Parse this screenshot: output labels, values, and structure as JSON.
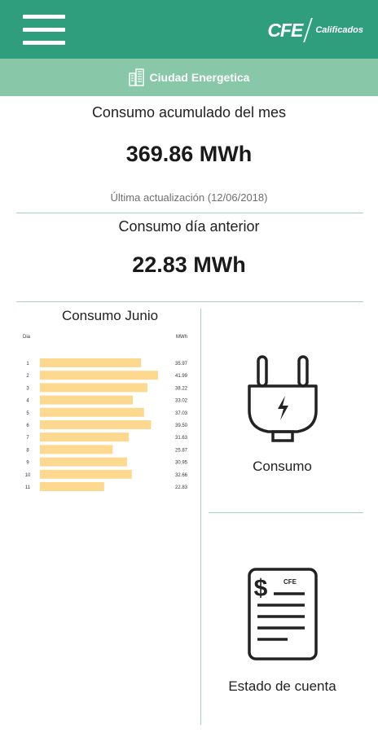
{
  "header": {
    "brand_logo": "CFE",
    "brand_sub": "Calificados",
    "subtitle": "Ciudad Energetica"
  },
  "monthly": {
    "title": "Consumo acumulado del mes",
    "value": "369.86 MWh",
    "updated": "Última actualización (12/06/2018)"
  },
  "previous_day": {
    "title": "Consumo día anterior",
    "value": "22.83 MWh"
  },
  "chart_data": {
    "type": "bar",
    "orientation": "horizontal",
    "title": "Consumo Junio",
    "col_left": "Dia",
    "col_right": "MWh",
    "categories": [
      "1",
      "2",
      "3",
      "4",
      "5",
      "6",
      "7",
      "8",
      "9",
      "10",
      "11"
    ],
    "values": [
      35.97,
      41.99,
      38.22,
      33.02,
      37.03,
      39.5,
      31.63,
      25.87,
      30.95,
      32.66,
      22.83
    ],
    "labels": [
      "35.97",
      "41.99",
      "38.22",
      "33.02",
      "37.03",
      "39.50",
      "31.63",
      "25.87",
      "30.95",
      "32.66",
      "22.83"
    ],
    "bar_color": "#fcd98e"
  },
  "tiles": {
    "consumo": {
      "label": "Consumo",
      "icon": "plug-icon"
    },
    "estado": {
      "label": "Estado de cuenta",
      "icon": "bill-icon",
      "icon_text": "CFE"
    }
  },
  "colors": {
    "primary": "#2f9e7c",
    "secondary": "#88c7a8",
    "divider": "#a7cfc2"
  }
}
